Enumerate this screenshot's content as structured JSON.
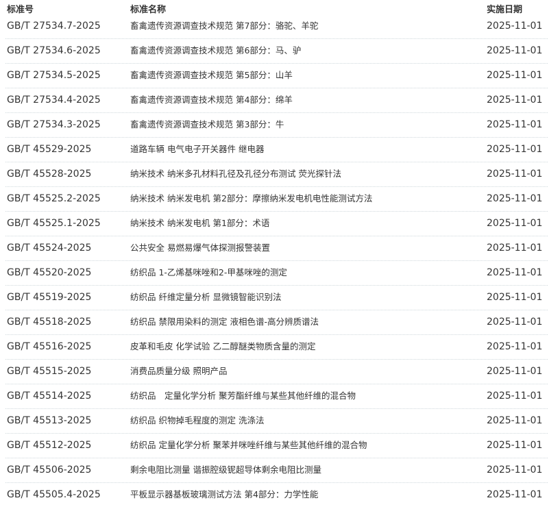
{
  "table": {
    "headers": {
      "code": "标准号",
      "name": "标准名称",
      "date": "实施日期"
    },
    "rows": [
      {
        "code": "GB/T 27534.7-2025",
        "name": "畜禽遗传资源调查技术规范 第7部分：骆驼、羊驼",
        "date": "2025-11-01"
      },
      {
        "code": "GB/T 27534.6-2025",
        "name": "畜禽遗传资源调查技术规范 第6部分：马、驴",
        "date": "2025-11-01"
      },
      {
        "code": "GB/T 27534.5-2025",
        "name": "畜禽遗传资源调查技术规范 第5部分：山羊",
        "date": "2025-11-01"
      },
      {
        "code": "GB/T 27534.4-2025",
        "name": "畜禽遗传资源调查技术规范 第4部分：绵羊",
        "date": "2025-11-01"
      },
      {
        "code": "GB/T 27534.3-2025",
        "name": "畜禽遗传资源调查技术规范 第3部分：牛",
        "date": "2025-11-01"
      },
      {
        "code": "GB/T 45529-2025",
        "name": "道路车辆 电气电子开关器件 继电器",
        "date": "2025-11-01"
      },
      {
        "code": "GB/T 45528-2025",
        "name": "纳米技术 纳米多孔材料孔径及孔径分布测试 荧光探针法",
        "date": "2025-11-01"
      },
      {
        "code": "GB/T 45525.2-2025",
        "name": "纳米技术 纳米发电机 第2部分：摩擦纳米发电机电性能测试方法",
        "date": "2025-11-01"
      },
      {
        "code": "GB/T 45525.1-2025",
        "name": "纳米技术 纳米发电机 第1部分：术语",
        "date": "2025-11-01"
      },
      {
        "code": "GB/T 45524-2025",
        "name": "公共安全 易燃易爆气体探测报警装置",
        "date": "2025-11-01"
      },
      {
        "code": "GB/T 45520-2025",
        "name": "纺织品 1-乙烯基咪唑和2-甲基咪唑的测定",
        "date": "2025-11-01"
      },
      {
        "code": "GB/T 45519-2025",
        "name": "纺织品 纤维定量分析 显微镜智能识别法",
        "date": "2025-11-01"
      },
      {
        "code": "GB/T 45518-2025",
        "name": "纺织品 禁限用染料的测定 液相色谱-高分辨质谱法",
        "date": "2025-11-01"
      },
      {
        "code": "GB/T 45516-2025",
        "name": "皮革和毛皮 化学试验 乙二醇醚类物质含量的测定",
        "date": "2025-11-01"
      },
      {
        "code": "GB/T 45515-2025",
        "name": "消费品质量分级 照明产品",
        "date": "2025-11-01"
      },
      {
        "code": "GB/T 45514-2025",
        "name": "纺织品　定量化学分析 聚芳酯纤维与某些其他纤维的混合物",
        "date": "2025-11-01"
      },
      {
        "code": "GB/T 45513-2025",
        "name": "纺织品 织物掉毛程度的测定 洗涤法",
        "date": "2025-11-01"
      },
      {
        "code": "GB/T 45512-2025",
        "name": "纺织品 定量化学分析 聚苯并咪唑纤维与某些其他纤维的混合物",
        "date": "2025-11-01"
      },
      {
        "code": "GB/T 45506-2025",
        "name": "剩余电阻比测量 谐振腔级铌超导体剩余电阻比测量",
        "date": "2025-11-01"
      },
      {
        "code": "GB/T 45505.4-2025",
        "name": "平板显示器基板玻璃测试方法 第4部分：力学性能",
        "date": "2025-11-01"
      }
    ]
  }
}
